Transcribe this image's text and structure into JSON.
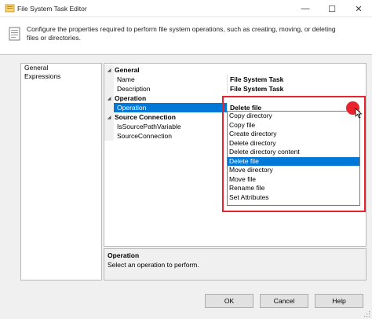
{
  "window": {
    "title": "File System Task Editor",
    "minimize_glyph": "—",
    "maximize_glyph": "☐",
    "close_glyph": "✕"
  },
  "header": {
    "description": "Configure the properties required to perform file system operations, such as creating, moving, or deleting files or directories."
  },
  "nav": {
    "items": [
      {
        "label": "General"
      },
      {
        "label": "Expressions"
      }
    ]
  },
  "grid": {
    "categories": {
      "general": "General",
      "operation": "Operation",
      "source_connection": "Source Connection"
    },
    "properties": {
      "name": {
        "label": "Name",
        "value": "File System Task"
      },
      "description": {
        "label": "Description",
        "value": "File System Task"
      },
      "operation": {
        "label": "Operation",
        "value": "Delete file"
      },
      "is_source_path_variable": {
        "label": "IsSourcePathVariable",
        "value": ""
      },
      "source_connection": {
        "label": "SourceConnection",
        "value": ""
      }
    }
  },
  "dropdown": {
    "options": [
      "Copy directory",
      "Copy file",
      "Create directory",
      "Delete directory",
      "Delete directory content",
      "Delete file",
      "Move directory",
      "Move file",
      "Rename file",
      "Set Attributes"
    ],
    "selected": "Delete file"
  },
  "description_panel": {
    "title": "Operation",
    "text": "Select an operation to perform."
  },
  "buttons": {
    "ok": "OK",
    "cancel": "Cancel",
    "help": "Help"
  },
  "colors": {
    "highlight": "#e8232d",
    "selection": "#0078d7"
  }
}
